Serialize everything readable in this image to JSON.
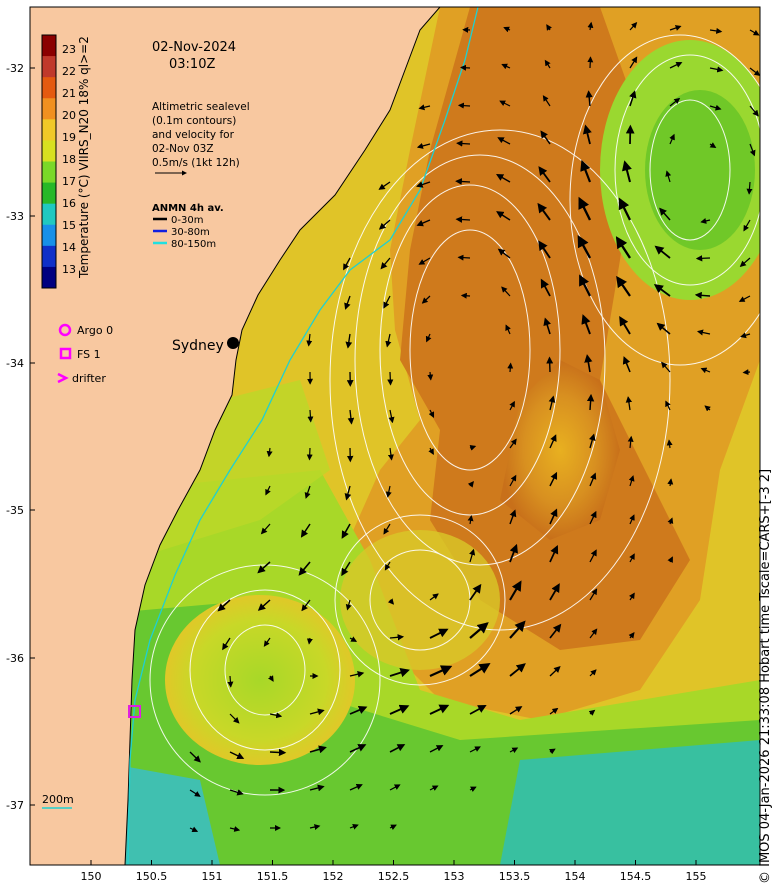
{
  "header": {
    "date": "02-Nov-2024",
    "time": "03:10Z"
  },
  "colorbar": {
    "label": "Temperature (°C) VIIRS_N20 18% ql>=2",
    "ticks": [
      "23",
      "22",
      "21",
      "20",
      "19",
      "18",
      "17",
      "16",
      "15",
      "14",
      "13"
    ],
    "colors": [
      "#8b0000",
      "#c0392b",
      "#e45a10",
      "#f09020",
      "#f0c828",
      "#d8e020",
      "#7ad828",
      "#28b828",
      "#20c8c0",
      "#1890e8",
      "#1030c8",
      "#000080"
    ]
  },
  "altimetry_note": {
    "lines": [
      "Altimetric sealevel",
      "(0.1m contours)",
      "and velocity for",
      "02-Nov 03Z",
      "0.5m/s (1kt 12h)"
    ]
  },
  "anmn_legend": {
    "title": "ANMN 4h av.",
    "items": [
      {
        "label": "0-30m",
        "color": "#000000"
      },
      {
        "label": "30-80m",
        "color": "#1020e0"
      },
      {
        "label": "80-150m",
        "color": "#20e0e0"
      }
    ]
  },
  "platform_legend": {
    "items": [
      {
        "label": "Argo 0",
        "color": "#ff00ff",
        "icon": "circle-icon"
      },
      {
        "label": "FS 1",
        "color": "#ff00ff",
        "icon": "square-icon"
      },
      {
        "label": "drifter",
        "color": "#ff00ff",
        "icon": "chevron-icon"
      }
    ]
  },
  "places": {
    "sydney": "Sydney",
    "depth_contour": "200m"
  },
  "axes": {
    "lat_ticks": [
      "-32",
      "-33",
      "-34",
      "-35",
      "-36",
      "-37"
    ],
    "lon_ticks": [
      "150",
      "150.5",
      "151",
      "151.5",
      "152",
      "152.5",
      "153",
      "153.5",
      "154",
      "154.5",
      "155"
    ]
  },
  "footer": "© IMOS 04-Jan-2026 21:33:08 Hobart time Tscale=CARS+[-3 2]",
  "palette": {
    "land": "#f8c8a0",
    "warm_core": "#d0701a",
    "warm": "#e8a020",
    "mid": "#e0c828",
    "cool": "#78d028",
    "cold": "#30c8a8"
  }
}
